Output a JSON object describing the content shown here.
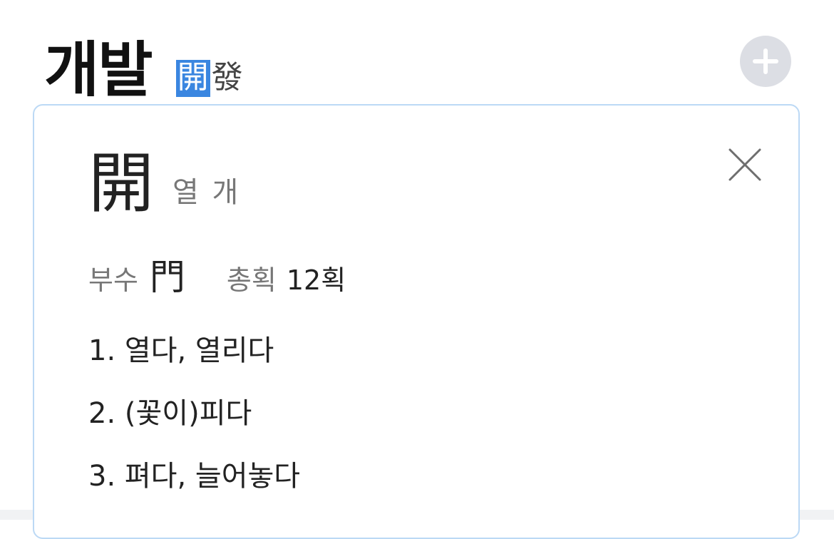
{
  "entry": {
    "word": "개발",
    "hanja": [
      {
        "char": "開",
        "selected": true
      },
      {
        "char": "發",
        "selected": false
      }
    ]
  },
  "add_button": {
    "icon": "plus-icon"
  },
  "hanja_card": {
    "character": "開",
    "reading": "열 개",
    "radical_label": "부수",
    "radical": "門",
    "strokes_label": "총획",
    "strokes_value": "12획",
    "meanings": [
      "1. 열다, 열리다",
      "2. (꽃이)피다",
      "3. 펴다, 늘어놓다"
    ],
    "close_icon": "close-icon"
  },
  "colors": {
    "selection": "#3a86e0",
    "card_border": "#bcd9f5",
    "add_button_bg": "#dcdee4",
    "muted_text": "#777777"
  }
}
